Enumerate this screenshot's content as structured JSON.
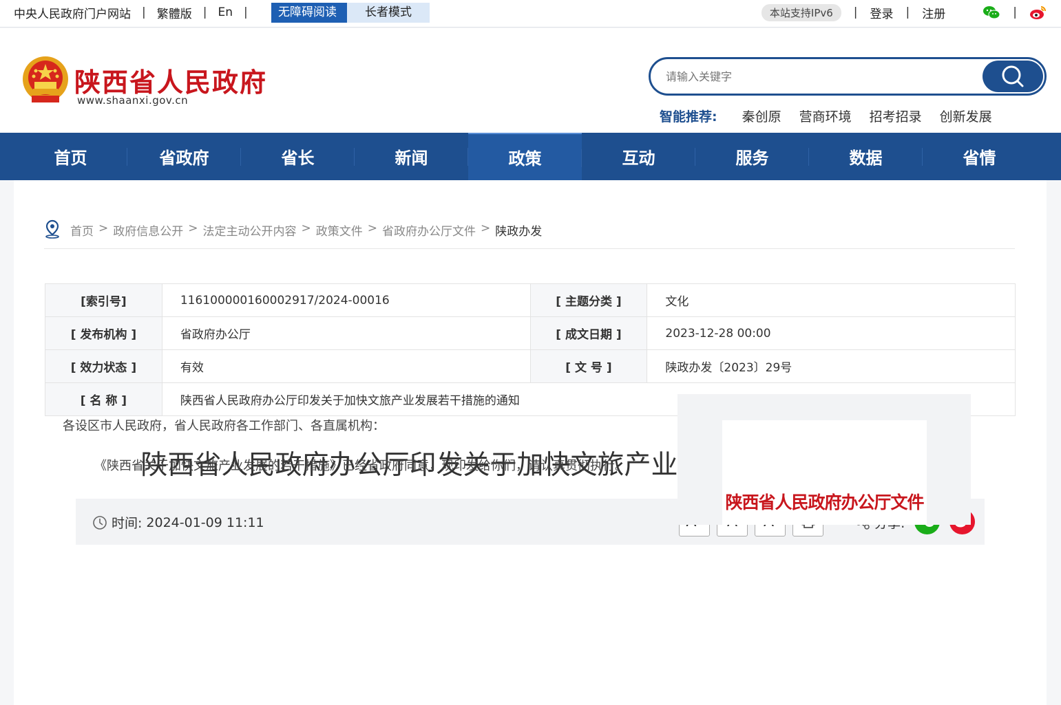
{
  "topbar": {
    "portal": "中央人民政府门户网站",
    "traditional": "繁體版",
    "english": "En",
    "accessible": "无障碍阅读",
    "elder": "长者模式",
    "ipv6": "本站支持IPv6",
    "login": "登录",
    "register": "注册"
  },
  "header": {
    "site_title": "陕西省人民政府",
    "site_url": "www.shaanxi.gov.cn",
    "search_placeholder": "请输入关键字",
    "rec_label": "智能推荐:",
    "rec_items": [
      "秦创原",
      "营商环境",
      "招考招录",
      "创新发展"
    ]
  },
  "nav": [
    "首页",
    "省政府",
    "省长",
    "新闻",
    "政策",
    "互动",
    "服务",
    "数据",
    "省情"
  ],
  "nav_active": "政策",
  "breadcrumb": [
    "首页",
    "政府信息公开",
    "法定主动公开内容",
    "政策文件",
    "省政府办公厅文件",
    "陕政办发"
  ],
  "meta": {
    "index_no_label": "[索引号]",
    "index_no": "11610000016000​2917/2024-00016",
    "topic_label": "[ 主题分类 ]",
    "topic": "文化",
    "publisher_label": "[ 发布机构 ]",
    "publisher": "省政府办公厅",
    "date_label": "[ 成文日期 ]",
    "date": "2023-12-28 00:00",
    "status_label": "[ 效力状态 ]",
    "status": "有效",
    "doc_no_label": "[ 文 号 ]",
    "doc_no": "陕政办发〔2023〕29号",
    "name_label": "[ 名 称 ]",
    "name": "陕西省人民政府办公厅印发关于加快文旅产业发展若干措施的通知"
  },
  "article": {
    "title": "陕西省人民政府办公厅印发关于加快文旅产业发展若干措施的通知",
    "time_label": "时间:",
    "time": "2024-01-09 11:11",
    "font_up": "A",
    "font_mid": "A",
    "font_down": "A",
    "share_label": "分享:",
    "p1": "各设区市人民政府，省人民政府各工作部门、各直属机构：",
    "p2": "《陕西省关于加快文旅产业发展的若干措施》已经省政府同意，现印发给你们，请认真贯彻执行。",
    "doc_header": "陕西省人民政府办公厅文件"
  },
  "colors": {
    "brand_blue": "#1e4f8f",
    "brand_red": "#c8161d",
    "wechat_green": "#1aad19",
    "weibo_red": "#e6162d"
  }
}
